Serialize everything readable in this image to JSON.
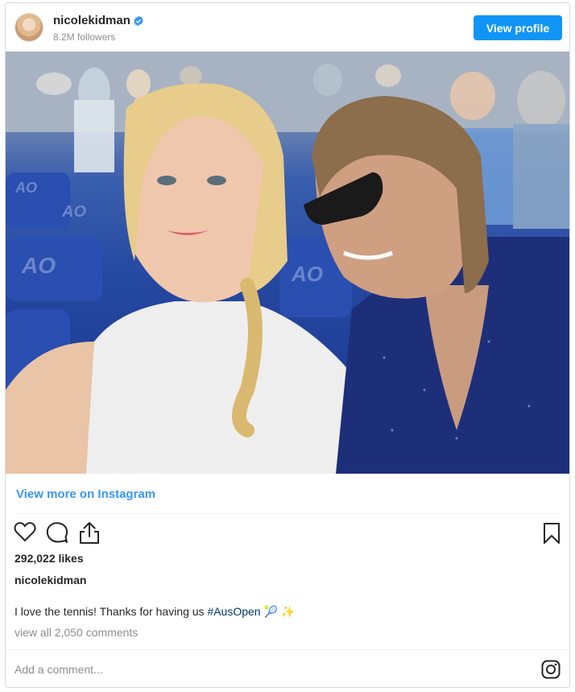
{
  "header": {
    "username": "nicolekidman",
    "followers": "8.2M followers",
    "view_profile_label": "View profile"
  },
  "post": {
    "image_alt": "Selfie of Nicole Kidman and Keith Urban at the Australian Open",
    "view_more_label": "View more on Instagram",
    "likes": "292,022 likes",
    "caption_username": "nicolekidman",
    "caption_text": "I love the tennis! Thanks for having us ",
    "caption_hashtag": "#AusOpen",
    "caption_emoji": "🎾 ✨",
    "view_comments": "view all 2,050 comments",
    "add_comment_placeholder": "Add a comment..."
  },
  "icons": {
    "verified": "verified-badge-icon",
    "like": "heart-icon",
    "comment": "comment-icon",
    "share": "share-icon",
    "save": "bookmark-icon",
    "instagram": "instagram-logo-icon"
  },
  "colors": {
    "primary_button": "#1195f5",
    "link": "#3897f0",
    "hashtag": "#003569",
    "muted_text": "#8e8e8e"
  }
}
